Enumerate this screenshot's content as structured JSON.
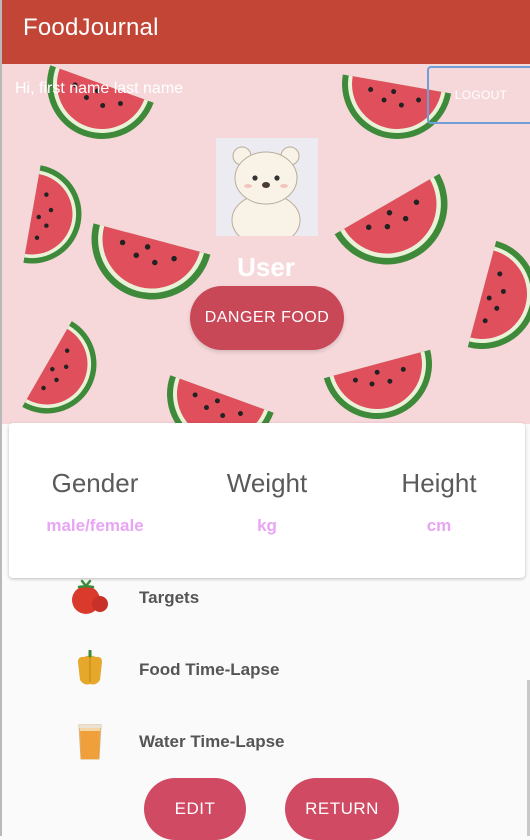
{
  "app": {
    "title": "FoodJournal"
  },
  "header": {
    "greeting": "Hi, first name last name",
    "logout_label": "LOGOUT",
    "username": "User",
    "danger_food_label": "DANGER FOOD"
  },
  "stats": [
    {
      "label": "Gender",
      "value": "male/female"
    },
    {
      "label": "Weight",
      "value": "kg"
    },
    {
      "label": "Height",
      "value": "cm"
    }
  ],
  "menu": [
    {
      "label": "Targets",
      "icon": "tomato-icon"
    },
    {
      "label": "Food Time-Lapse",
      "icon": "bell-pepper-icon"
    },
    {
      "label": "Water Time-Lapse",
      "icon": "juice-glass-icon"
    }
  ],
  "actions": {
    "edit_label": "EDIT",
    "return_label": "RETURN"
  },
  "colors": {
    "app_bar": "#c24536",
    "hero_background": "#f7d8da",
    "button_accent": "#cf4a62",
    "stat_value": "#e8a5f4"
  }
}
